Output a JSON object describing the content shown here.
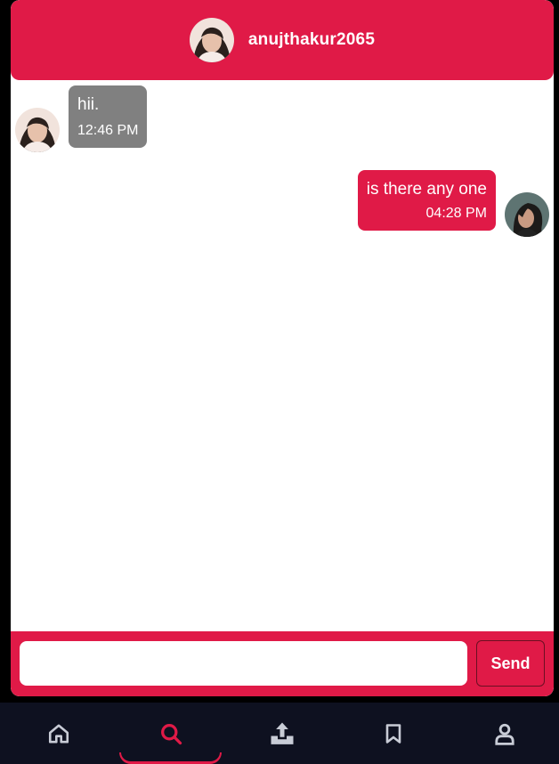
{
  "header": {
    "username": "anujthakur2065"
  },
  "messages": [
    {
      "direction": "incoming",
      "text": "hii.",
      "time": "12:46 PM"
    },
    {
      "direction": "outgoing",
      "text": "is there any one",
      "time": "04:28 PM"
    }
  ],
  "composer": {
    "input_value": "",
    "send_label": "Send"
  },
  "nav": {
    "items": [
      {
        "icon": "home-icon",
        "active": false
      },
      {
        "icon": "search-icon",
        "active": true
      },
      {
        "icon": "upload-icon",
        "active": false
      },
      {
        "icon": "bookmark-icon",
        "active": false
      },
      {
        "icon": "user-icon",
        "active": false
      }
    ]
  },
  "colors": {
    "accent": "#e01a47",
    "incoming_bubble": "#808080",
    "nav_background": "#0e1120",
    "nav_icon": "#c8ccd6"
  }
}
